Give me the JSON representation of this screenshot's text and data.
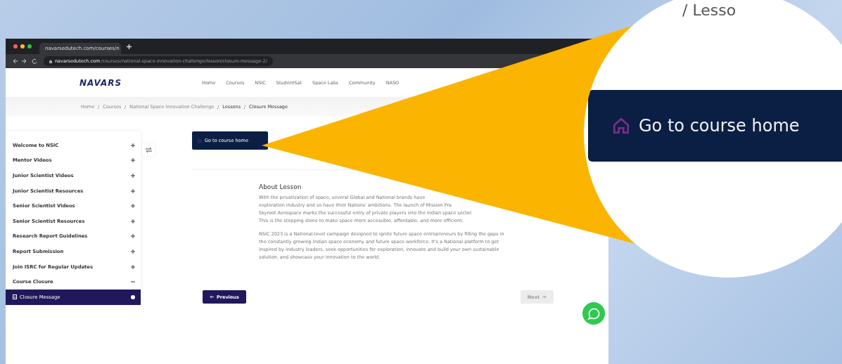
{
  "browser": {
    "tab": "navarsedutech.com/courses/n",
    "url_host": "navarsedutech.com",
    "url_path": "/courses/national-space-innovation-challenge/lesson/closure-message-2/"
  },
  "header": {
    "logo": "NAVARS",
    "nav": [
      "Home",
      "Courses",
      "NSIC",
      "StudentSat",
      "Space Labs",
      "Community",
      "NASO"
    ]
  },
  "breadcrumb": [
    {
      "label": "Home",
      "current": false
    },
    {
      "label": "Courses",
      "current": false
    },
    {
      "label": "National Space Innovation Challenge",
      "current": false
    },
    {
      "label": "Lessons",
      "current": true
    },
    {
      "label": "Closure Message",
      "current": true
    }
  ],
  "sidebar": {
    "items": [
      {
        "label": "Welcome to NSIC",
        "kind": "section",
        "expanded": false
      },
      {
        "label": "Mentor Videos",
        "kind": "section",
        "expanded": false
      },
      {
        "label": "Junior Scientist Videos",
        "kind": "section",
        "expanded": false
      },
      {
        "label": "Junior Scientist Resources",
        "kind": "section",
        "expanded": false
      },
      {
        "label": "Senior Scientist Videos",
        "kind": "section",
        "expanded": false
      },
      {
        "label": "Senior Scientist Resources",
        "kind": "section",
        "expanded": false
      },
      {
        "label": "Research Report Guidelines",
        "kind": "section",
        "expanded": false
      },
      {
        "label": "Report Submission",
        "kind": "section",
        "expanded": false
      },
      {
        "label": "Join ISRC for Regular Updates",
        "kind": "section",
        "expanded": false
      },
      {
        "label": "Course Closure",
        "kind": "section",
        "expanded": true
      },
      {
        "label": "Closure Message",
        "kind": "lesson",
        "selected": true
      }
    ]
  },
  "course_home": "Go to course home",
  "lesson": {
    "title": "About Lesson",
    "paragraph_1_lines": [
      "With the privatization of space, several Global and National brands have",
      "exploration industry and so have their Nations' ambitions. The launch of Mission Pra",
      "Skyroot Aerospace marks the successful entry of private players into the Indian space sector.",
      "This is the stepping stone to make space more accessible, affordable, and more efficient."
    ],
    "paragraph_2": "NSIC 2023 is a National-level campaign designed to ignite future space entrepreneurs by filling the gaps in the constantly growing Indian space economy and future space workforce. It's a National platform to get inspired by industry leaders, seek opportunities for exploration, innovate and build your own sustainable solution, and showcase your innovation to the world."
  },
  "pager": {
    "previous": "Previous",
    "next": "Next",
    "next_disabled": true
  },
  "magnifier": {
    "breadcrumb_fragment": "/ Lesso",
    "button": "Go to course home"
  }
}
